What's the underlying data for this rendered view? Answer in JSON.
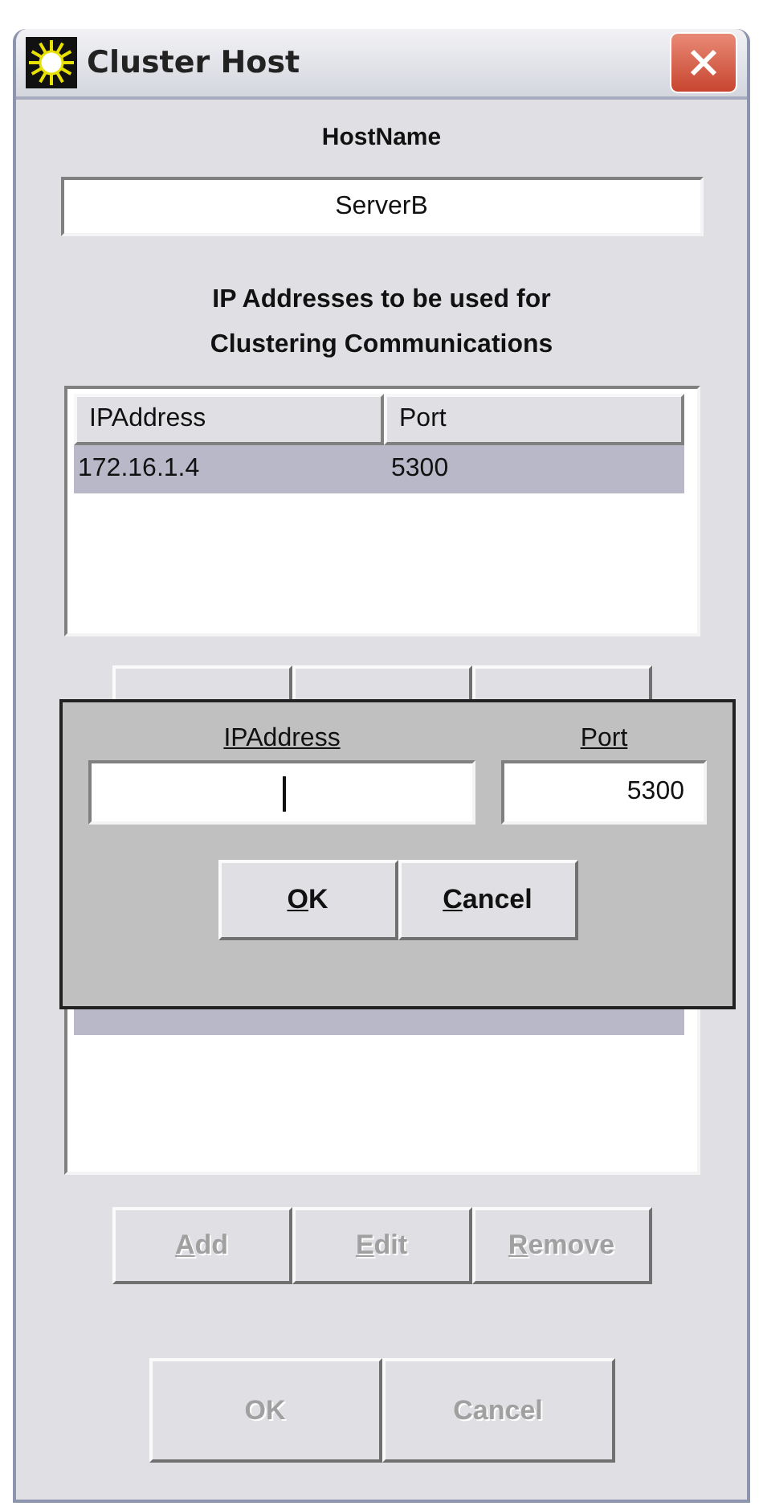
{
  "window": {
    "title": "Cluster Host"
  },
  "hostname": {
    "label": "HostName",
    "value": "ServerB"
  },
  "clustering": {
    "heading_lines": [
      "IP Addresses to be used for",
      "Clustering Communications"
    ],
    "table": {
      "columns": [
        "IPAddress",
        "Port"
      ],
      "rows": [
        {
          "cells": [
            "172.16.1.4",
            "5300"
          ],
          "selected": true
        }
      ]
    }
  },
  "second_table": {
    "rows": [
      {
        "selected": true
      }
    ]
  },
  "list_buttons": [
    {
      "label": "Add",
      "mnemonic": true,
      "disabled": true
    },
    {
      "label": "Edit",
      "mnemonic": true,
      "disabled": true
    },
    {
      "label": "Remove",
      "mnemonic": true,
      "disabled": true
    }
  ],
  "dialog_buttons": [
    {
      "label": "OK",
      "mnemonic": false,
      "disabled": true
    },
    {
      "label": "Cancel",
      "mnemonic": false,
      "disabled": true
    }
  ],
  "popup": {
    "fields": [
      {
        "label": "IPAddress",
        "focused": true
      },
      {
        "label": "Port",
        "value": "5300",
        "focused": false
      }
    ],
    "buttons": [
      {
        "label": "OK",
        "mnemonic": true,
        "disabled": false
      },
      {
        "label": "Cancel",
        "mnemonic": true,
        "disabled": false
      }
    ]
  }
}
